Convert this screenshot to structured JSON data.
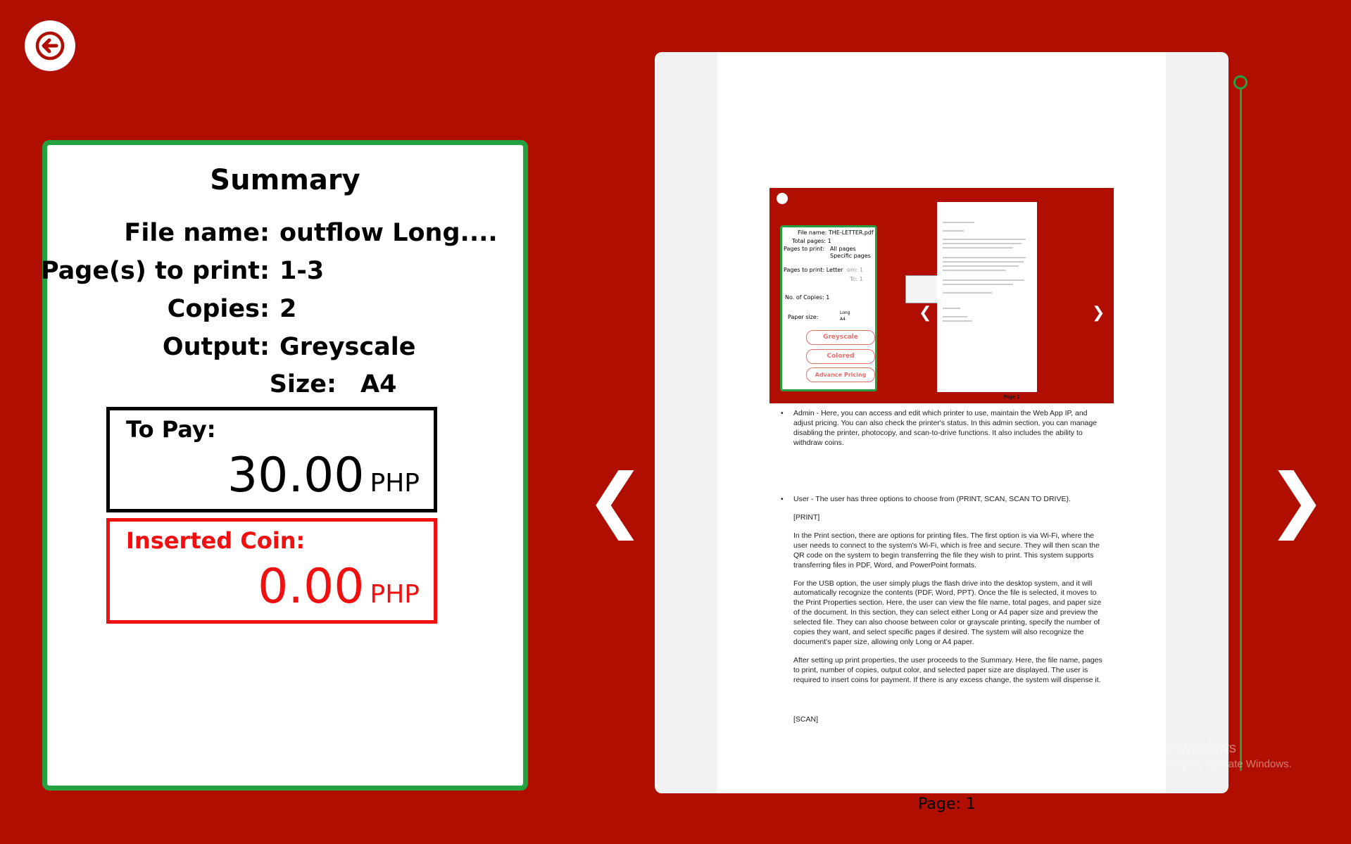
{
  "summary": {
    "title": "Summary",
    "rows": [
      {
        "label": "File name:",
        "value": "outflow Long...."
      },
      {
        "label": "Page(s) to print:",
        "value": "1-3"
      },
      {
        "label": "Copies:",
        "value": "2"
      },
      {
        "label": "Output:",
        "value": "Greyscale"
      },
      {
        "label": "Size:",
        "value": "A4"
      }
    ],
    "to_pay": {
      "label": "To Pay:",
      "amount": "30.00",
      "currency": "PHP"
    },
    "inserted_coin": {
      "label": "Inserted Coin:",
      "amount": "0.00",
      "currency": "PHP"
    }
  },
  "preview": {
    "page_label": "Page: 1",
    "prev_arrow": "❮",
    "next_arrow": "❯",
    "mini": {
      "file_name_label": "File name:",
      "file_name": "THE-LETTER.pdf",
      "total_pages_label": "Total pages:",
      "total_pages": "1",
      "pages_to_print_label": "Pages to print:",
      "all_pages": "All pages",
      "specific_pages": "Specific pages",
      "pages_to_print_label2": "Pages to print:",
      "letter": "Letter",
      "from_label": "om:",
      "from_value": "1",
      "to_label": "To:",
      "to_value": "1",
      "copies_label": "No. of Copies:",
      "copies_value": "1",
      "paper_size_label": "Paper size:",
      "paper_long": "Long",
      "paper_a4": "A4",
      "btn_greyscale": "Greyscale",
      "btn_colored": "Colored",
      "btn_advance": "Advance Pricing",
      "page_caption": "Page 1"
    },
    "doc": {
      "admin": "Admin - Here, you can access and edit which printer to use, maintain the Web App IP, and adjust pricing. You can also check the printer's status. In this admin section, you can manage disabling the printer, photocopy, and scan-to-drive functions. It also includes the ability to withdraw coins.",
      "user": "User - The user has three options to choose from (PRINT, SCAN, SCAN TO DRIVE).",
      "print_heading": "[PRINT]",
      "p1": "In the Print section, there are options for printing files. The first option is via Wi-Fi, where the user needs to connect to the system's Wi-Fi, which is free and secure. They will then scan the QR code on the system to begin transferring the file they wish to print. This system supports transferring files in PDF, Word, and PowerPoint formats.",
      "p2": "For the USB option, the user simply plugs the flash drive into the desktop system, and it will automatically recognize the contents (PDF, Word, PPT). Once the file is selected, it moves to the Print Properties section. Here, the user can view the file name, total pages, and paper size of the document. In this section, they can select either Long or A4 paper size and preview the selected file. They can also choose between color or grayscale printing, specify the number of copies they want, and select specific pages if desired. The system will also recognize the document's paper size, allowing only Long or A4 paper.",
      "p3": "After setting up print properties, the user proceeds to the Summary. Here, the file name, pages to print, number of copies, output color, and selected paper size are displayed. The user is required to insert coins for payment. If there is any excess change, the system will dispense it.",
      "scan_heading": "[SCAN]"
    }
  },
  "watermark": {
    "line1": "Activate Windows",
    "line2": "Go to Settings to activate Windows."
  },
  "colors": {
    "background": "#b00e00",
    "panel_border": "#24a140",
    "coin_red": "#f10f0f"
  },
  "icons": {
    "back": "arrow-left-icon",
    "prev": "chevron-left-icon",
    "next": "chevron-right-icon"
  }
}
